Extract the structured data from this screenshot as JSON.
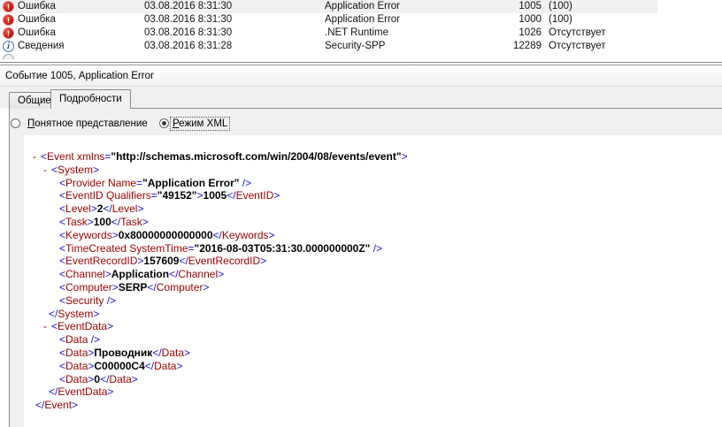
{
  "event_list": {
    "rows": [
      {
        "level": "Ошибка",
        "icon": "error-icon",
        "date": "03.08.2016 8:31:30",
        "source": "Application Error",
        "event_id": "1005",
        "category": "(100)",
        "selected": true
      },
      {
        "level": "Ошибка",
        "icon": "error-icon",
        "date": "03.08.2016 8:31:30",
        "source": "Application Error",
        "event_id": "1000",
        "category": "(100)",
        "selected": false
      },
      {
        "level": "Ошибка",
        "icon": "error-icon",
        "date": "03.08.2016 8:31:30",
        "source": ".NET Runtime",
        "event_id": "1026",
        "category": "Отсутствует",
        "selected": false
      },
      {
        "level": "Сведения",
        "icon": "info-icon",
        "date": "03.08.2016 8:31:28",
        "source": "Security-SPP",
        "event_id": "12289",
        "category": "Отсутствует",
        "selected": false
      }
    ]
  },
  "preview": {
    "title": "Событие 1005, Application Error",
    "tabs": [
      {
        "label": "Общие",
        "active": false
      },
      {
        "label": "Подробности",
        "active": true
      }
    ],
    "radios": [
      {
        "accel": "П",
        "rest": "онятное представление",
        "selected": false,
        "focused": false
      },
      {
        "accel": "Р",
        "rest": "ежим XML",
        "selected": true,
        "focused": true
      }
    ]
  },
  "xml": {
    "lines": [
      {
        "pad": 37,
        "tokens": [
          [
            "d",
            "-"
          ],
          [
            "b",
            "<"
          ],
          [
            "n",
            "Event"
          ],
          [
            "a",
            " xmlns"
          ],
          [
            "e",
            "="
          ],
          [
            "v",
            "\"http://schemas.microsoft.com/win/2004/08/events/event\""
          ],
          [
            "b",
            ">"
          ]
        ]
      },
      {
        "pad": 49,
        "tokens": [
          [
            "d",
            "-"
          ],
          [
            "b",
            "<"
          ],
          [
            "n",
            "System"
          ],
          [
            "b",
            ">"
          ]
        ]
      },
      {
        "pad": 67,
        "tokens": [
          [
            "b",
            "<"
          ],
          [
            "n",
            "Provider"
          ],
          [
            "a",
            " Name"
          ],
          [
            "e",
            "="
          ],
          [
            "v",
            "\"Application Error\""
          ],
          [
            "b",
            " />"
          ]
        ]
      },
      {
        "pad": 67,
        "tokens": [
          [
            "b",
            "<"
          ],
          [
            "n",
            "EventID"
          ],
          [
            "a",
            " Qualifiers"
          ],
          [
            "e",
            "="
          ],
          [
            "v",
            "\"49152\""
          ],
          [
            "b",
            ">"
          ],
          [
            "x",
            "1005"
          ],
          [
            "b",
            "</"
          ],
          [
            "n",
            "EventID"
          ],
          [
            "b",
            ">"
          ]
        ]
      },
      {
        "pad": 67,
        "tokens": [
          [
            "b",
            "<"
          ],
          [
            "n",
            "Level"
          ],
          [
            "b",
            ">"
          ],
          [
            "x",
            "2"
          ],
          [
            "b",
            "</"
          ],
          [
            "n",
            "Level"
          ],
          [
            "b",
            ">"
          ]
        ]
      },
      {
        "pad": 67,
        "tokens": [
          [
            "b",
            "<"
          ],
          [
            "n",
            "Task"
          ],
          [
            "b",
            ">"
          ],
          [
            "x",
            "100"
          ],
          [
            "b",
            "</"
          ],
          [
            "n",
            "Task"
          ],
          [
            "b",
            ">"
          ]
        ]
      },
      {
        "pad": 67,
        "tokens": [
          [
            "b",
            "<"
          ],
          [
            "n",
            "Keywords"
          ],
          [
            "b",
            ">"
          ],
          [
            "x",
            "0x80000000000000"
          ],
          [
            "b",
            "</"
          ],
          [
            "n",
            "Keywords"
          ],
          [
            "b",
            ">"
          ]
        ]
      },
      {
        "pad": 67,
        "tokens": [
          [
            "b",
            "<"
          ],
          [
            "n",
            "TimeCreated"
          ],
          [
            "a",
            " SystemTime"
          ],
          [
            "e",
            "="
          ],
          [
            "v",
            "\"2016-08-03T05:31:30.000000000Z\""
          ],
          [
            "b",
            " />"
          ]
        ]
      },
      {
        "pad": 67,
        "tokens": [
          [
            "b",
            "<"
          ],
          [
            "n",
            "EventRecordID"
          ],
          [
            "b",
            ">"
          ],
          [
            "x",
            "157609"
          ],
          [
            "b",
            "</"
          ],
          [
            "n",
            "EventRecordID"
          ],
          [
            "b",
            ">"
          ]
        ]
      },
      {
        "pad": 67,
        "tokens": [
          [
            "b",
            "<"
          ],
          [
            "n",
            "Channel"
          ],
          [
            "b",
            ">"
          ],
          [
            "x",
            "Application"
          ],
          [
            "b",
            "</"
          ],
          [
            "n",
            "Channel"
          ],
          [
            "b",
            ">"
          ]
        ]
      },
      {
        "pad": 67,
        "tokens": [
          [
            "b",
            "<"
          ],
          [
            "n",
            "Computer"
          ],
          [
            "b",
            ">"
          ],
          [
            "x",
            "SERP"
          ],
          [
            "b",
            "</"
          ],
          [
            "n",
            "Computer"
          ],
          [
            "b",
            ">"
          ]
        ]
      },
      {
        "pad": 67,
        "tokens": [
          [
            "b",
            "<"
          ],
          [
            "n",
            "Security"
          ],
          [
            "b",
            " />"
          ]
        ]
      },
      {
        "pad": 55,
        "tokens": [
          [
            "b",
            "</"
          ],
          [
            "n",
            "System"
          ],
          [
            "b",
            ">"
          ]
        ]
      },
      {
        "pad": 49,
        "tokens": [
          [
            "d",
            "-"
          ],
          [
            "b",
            "<"
          ],
          [
            "n",
            "EventData"
          ],
          [
            "b",
            ">"
          ]
        ]
      },
      {
        "pad": 67,
        "tokens": [
          [
            "b",
            "<"
          ],
          [
            "n",
            "Data"
          ],
          [
            "b",
            " />"
          ]
        ]
      },
      {
        "pad": 67,
        "tokens": [
          [
            "b",
            "<"
          ],
          [
            "n",
            "Data"
          ],
          [
            "b",
            ">"
          ],
          [
            "x",
            "Проводник"
          ],
          [
            "b",
            "</"
          ],
          [
            "n",
            "Data"
          ],
          [
            "b",
            ">"
          ]
        ]
      },
      {
        "pad": 67,
        "tokens": [
          [
            "b",
            "<"
          ],
          [
            "n",
            "Data"
          ],
          [
            "b",
            ">"
          ],
          [
            "x",
            "C00000C4"
          ],
          [
            "b",
            "</"
          ],
          [
            "n",
            "Data"
          ],
          [
            "b",
            ">"
          ]
        ]
      },
      {
        "pad": 67,
        "tokens": [
          [
            "b",
            "<"
          ],
          [
            "n",
            "Data"
          ],
          [
            "b",
            ">"
          ],
          [
            "x",
            "0"
          ],
          [
            "b",
            "</"
          ],
          [
            "n",
            "Data"
          ],
          [
            "b",
            ">"
          ]
        ]
      },
      {
        "pad": 55,
        "tokens": [
          [
            "b",
            "</"
          ],
          [
            "n",
            "EventData"
          ],
          [
            "b",
            ">"
          ]
        ]
      },
      {
        "pad": 40,
        "tokens": [
          [
            "b",
            "</"
          ],
          [
            "n",
            "Event"
          ],
          [
            "b",
            ">"
          ]
        ]
      }
    ]
  },
  "colors": {
    "selection_bg": "#f1f1f2",
    "panel_bg": "#f0f0f0",
    "xml_bracket": "#1414d6",
    "xml_name": "#990000",
    "xml_value": "#000000",
    "error_icon": "#c8120b",
    "info_icon": "#1f4e8c"
  }
}
